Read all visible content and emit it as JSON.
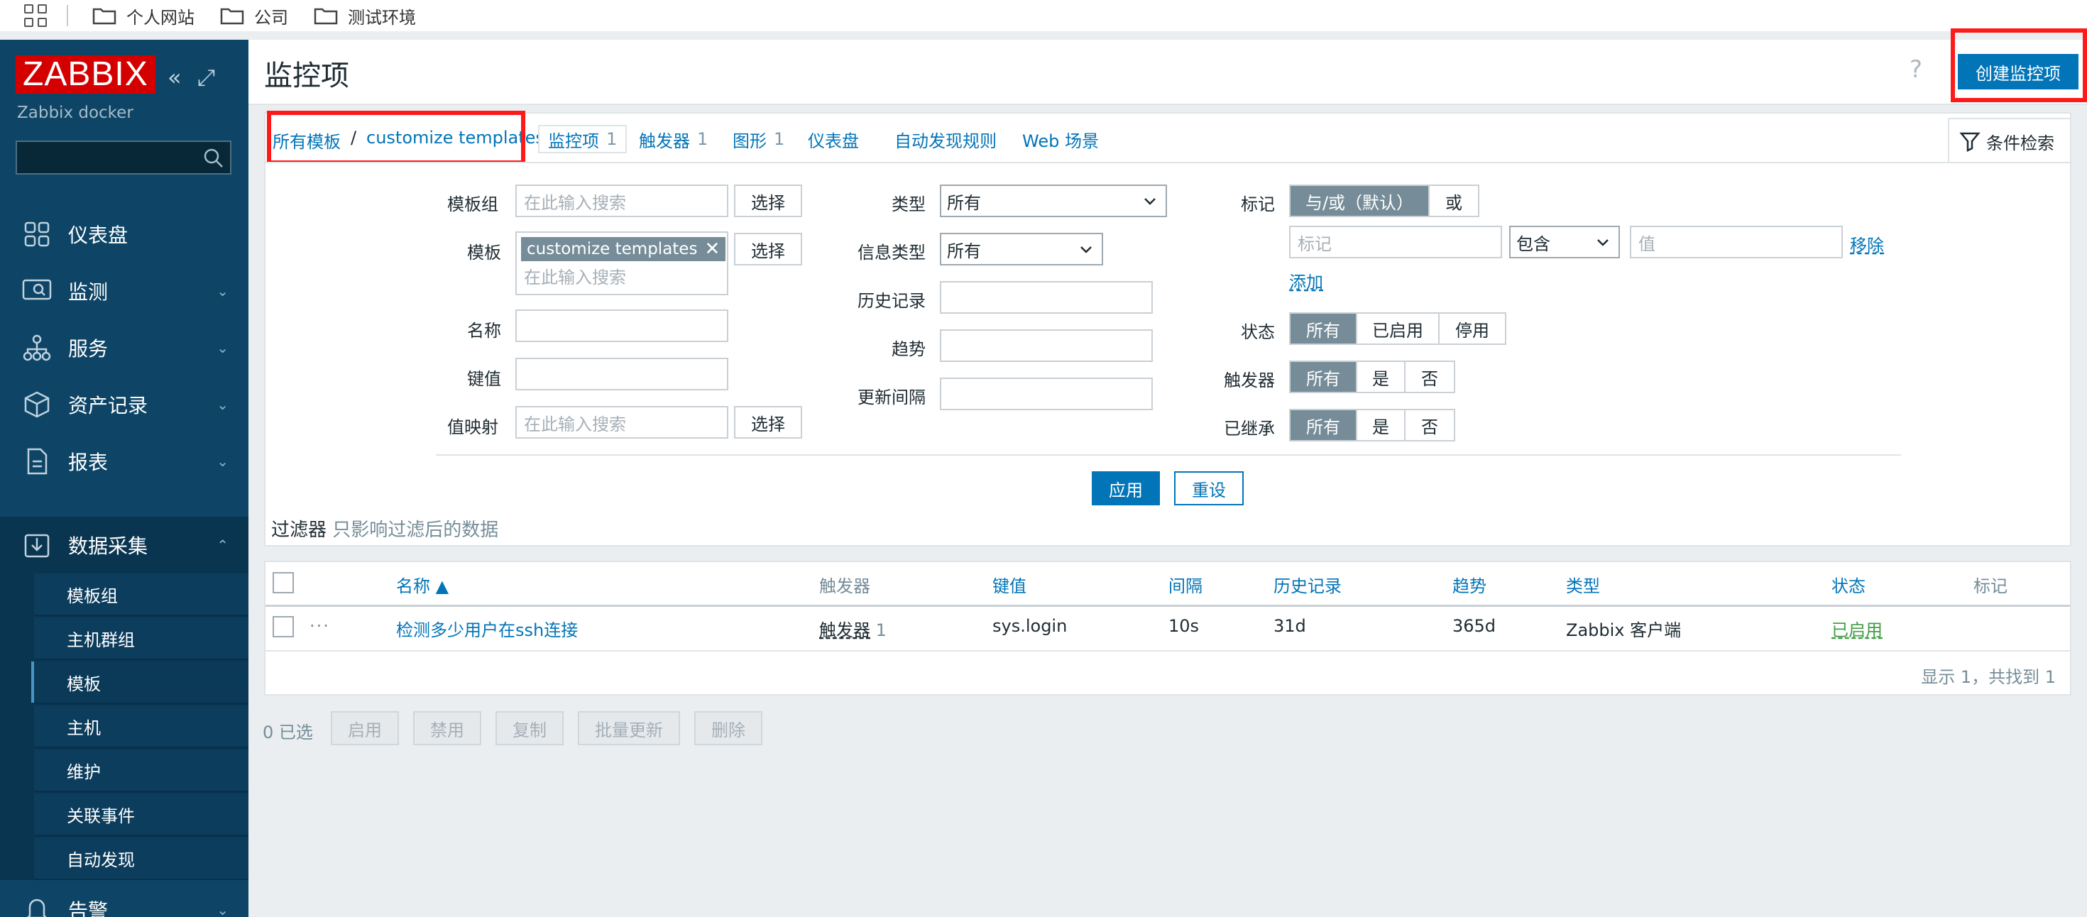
{
  "bookmarks": [
    "个人网站",
    "公司",
    "测试环境"
  ],
  "sidebar": {
    "logo": "ZABBIX",
    "subtitle": "Zabbix docker",
    "search_placeholder": "",
    "menu": [
      {
        "label": "仪表盘",
        "icon": "dashboard-icon",
        "has_chevron": false
      },
      {
        "label": "监测",
        "icon": "monitoring-icon",
        "has_chevron": true
      },
      {
        "label": "服务",
        "icon": "services-icon",
        "has_chevron": true
      },
      {
        "label": "资产记录",
        "icon": "inventory-icon",
        "has_chevron": true
      },
      {
        "label": "报表",
        "icon": "reports-icon",
        "has_chevron": true
      },
      {
        "label": "数据采集",
        "icon": "data-collection-icon",
        "has_chevron": true,
        "expanded": true
      },
      {
        "label": "告警",
        "icon": "bell-icon",
        "has_chevron": true
      }
    ],
    "submenu": [
      "模板组",
      "主机群组",
      "模板",
      "主机",
      "维护",
      "关联事件",
      "自动发现"
    ],
    "submenu_selected": "模板"
  },
  "header": {
    "title": "监控项",
    "help": "?",
    "create_button": "创建监控项"
  },
  "nav": {
    "breadcrumb_root": "所有模板",
    "breadcrumb_sep": "/",
    "breadcrumb_current": "customize templates",
    "tabs": [
      {
        "label": "监控项",
        "count": "1"
      },
      {
        "label": "触发器",
        "count": "1"
      },
      {
        "label": "图形",
        "count": "1"
      },
      {
        "label": "仪表盘",
        "count": ""
      },
      {
        "label": "自动发现规则",
        "count": ""
      },
      {
        "label": "Web 场景",
        "count": ""
      }
    ],
    "filter_tab": "条件检索"
  },
  "filter": {
    "template_group_label": "模板组",
    "template_label": "模板",
    "name_label": "名称",
    "key_label": "键值",
    "valuemap_label": "值映射",
    "search_placeholder": "在此输入搜索",
    "select_button": "选择",
    "template_chip": "customize templates",
    "type_label": "类型",
    "type_value": "所有",
    "info_type_label": "信息类型",
    "info_type_value": "所有",
    "history_label": "历史记录",
    "trends_label": "趋势",
    "interval_label": "更新间隔",
    "tags_label": "标记",
    "tags_mode": [
      "与/或（默认）",
      "或"
    ],
    "tag_placeholder": "标记",
    "tag_operator": "包含",
    "tag_value_placeholder": "值",
    "remove_link": "移除",
    "add_link": "添加",
    "status_label": "状态",
    "status_options": [
      "所有",
      "已启用",
      "停用"
    ],
    "triggers_label": "触发器",
    "triggers_options": [
      "所有",
      "是",
      "否"
    ],
    "inherited_label": "已继承",
    "inherited_options": [
      "所有",
      "是",
      "否"
    ],
    "apply": "应用",
    "reset": "重设",
    "note_title": "过滤器",
    "note_hint": "只影响过滤后的数据"
  },
  "table": {
    "columns": [
      "名称 ▲",
      "触发器",
      "键值",
      "间隔",
      "历史记录",
      "趋势",
      "类型",
      "状态",
      "标记"
    ],
    "rows": [
      {
        "menu": "···",
        "name": "检测多少用户在ssh连接",
        "triggers_label": "触发器",
        "triggers_count": "1",
        "key": "sys.login",
        "interval": "10s",
        "history": "31d",
        "trends": "365d",
        "type": "Zabbix 客户端",
        "status": "已启用",
        "tags": ""
      }
    ],
    "summary": "显示 1，共找到 1"
  },
  "actions": {
    "selected": "0 已选",
    "buttons": [
      "启用",
      "禁用",
      "复制",
      "批量更新",
      "删除"
    ]
  },
  "colors": {
    "sidebar_bg": "#0e4566",
    "logo_bg": "#d40000",
    "primary": "#0275b8",
    "status_enabled": "#429e47",
    "highlight_box": "#ff1a1a"
  }
}
